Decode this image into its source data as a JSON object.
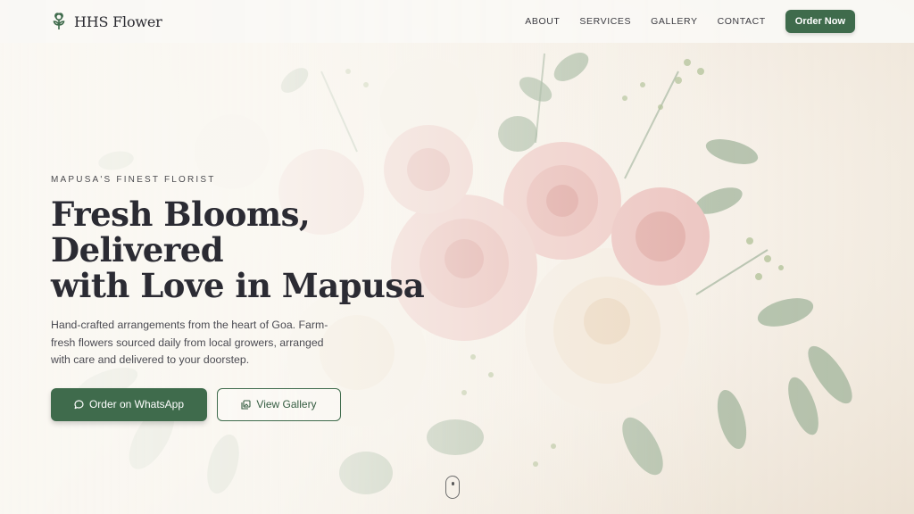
{
  "header": {
    "brand_name": "HHS Flower",
    "nav": [
      "ABOUT",
      "SERVICES",
      "GALLERY",
      "CONTACT"
    ],
    "order_button": "Order Now"
  },
  "hero": {
    "eyebrow": "MAPUSA'S FINEST FLORIST",
    "title_line1": "Fresh Blooms, Delivered",
    "title_line2": "with Love in Mapusa",
    "subtitle_line1": "Hand-crafted arrangements from the heart of Goa. Farm-",
    "subtitle_line2": "fresh flowers sourced daily from local growers, arranged",
    "subtitle_line3": "with care and delivered to your doorstep.",
    "primary_cta": "Order on WhatsApp",
    "secondary_cta": "View Gallery"
  },
  "colors": {
    "primary_green": "#3f6b4c",
    "text_dark": "#2b2b33",
    "background_cream": "#f4ede4"
  },
  "icons": {
    "brand": "flower-icon",
    "whatsapp": "chat-bubble-icon",
    "gallery": "image-gallery-icon",
    "scroll": "mouse-scroll-icon"
  }
}
